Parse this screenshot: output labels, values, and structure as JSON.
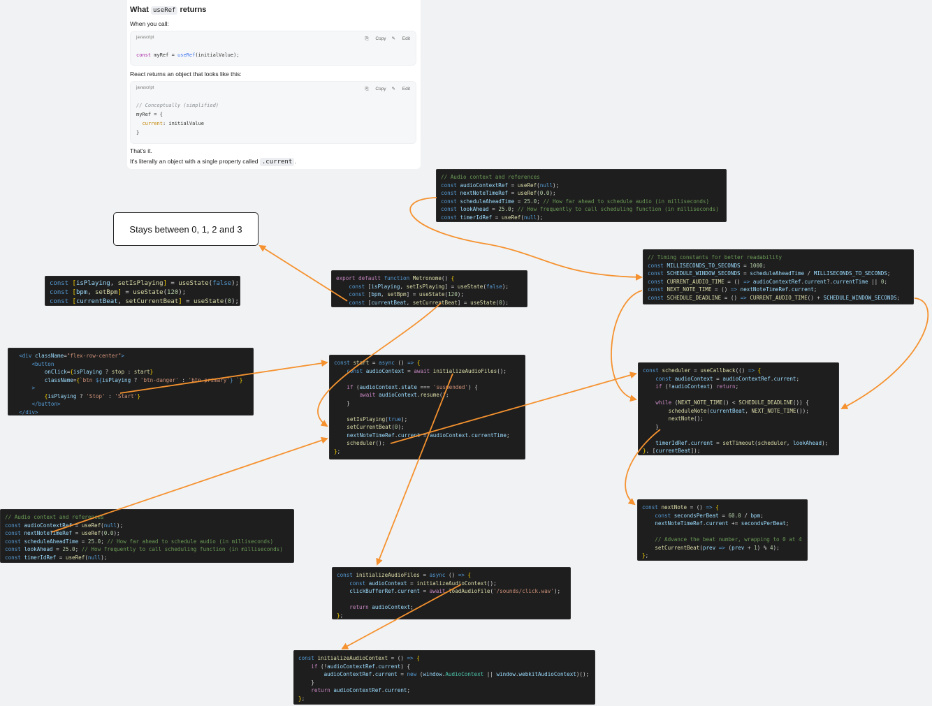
{
  "doc": {
    "heading_pre": "What ",
    "heading_code": "useRef",
    "heading_post": " returns",
    "p1": "When you call:",
    "block1": {
      "lang": "javascript",
      "copy": "Copy",
      "edit": "Edit"
    },
    "p2": "React returns an object that looks like this:",
    "block2": {
      "lang": "javascript",
      "copy": "Copy",
      "edit": "Edit",
      "comment": "// Conceptually (simplified)"
    },
    "p3": "That's it.",
    "p4_pre": "It's literally an object with a single property called ",
    "p4_code": ".current",
    "p4_post": "."
  },
  "note": {
    "text": "Stays between 0, 1, 2 and 3"
  },
  "colors": {
    "arrow": "#f5922f",
    "code_bg": "#1e1e1e",
    "canvas_bg": "#f1f2f4"
  }
}
